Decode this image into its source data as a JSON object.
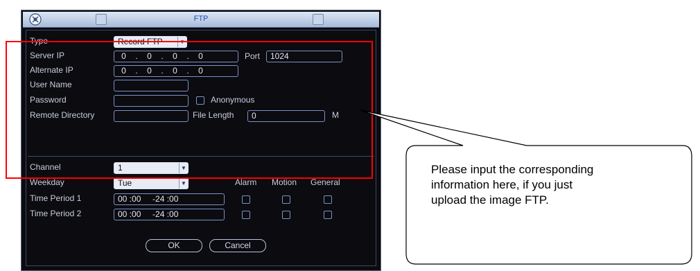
{
  "window": {
    "title": "FTP"
  },
  "form": {
    "type_label": "Type",
    "type_value": "Record FTP",
    "server_ip_label": "Server IP",
    "server_ip": [
      "0",
      "0",
      "0",
      "0"
    ],
    "port_label": "Port",
    "port_value": "1024",
    "alternate_ip_label": "Alternate IP",
    "alternate_ip": [
      "0",
      "0",
      "0",
      "0"
    ],
    "user_name_label": "User Name",
    "user_name_value": "",
    "password_label": "Password",
    "password_value": "",
    "anonymous_label": "Anonymous",
    "remote_dir_label": "Remote Directory",
    "remote_dir_value": "",
    "file_length_label": "File Length",
    "file_length_value": "0",
    "file_length_unit": "M"
  },
  "schedule": {
    "channel_label": "Channel",
    "channel_value": "1",
    "weekday_label": "Weekday",
    "weekday_value": "Tue",
    "col_alarm": "Alarm",
    "col_motion": "Motion",
    "col_general": "General",
    "period1_label": "Time Period 1",
    "period1_value": "00 :00     -24 :00",
    "period2_label": "Time Period 2",
    "period2_value": "00 :00     -24 :00"
  },
  "buttons": {
    "ok": "OK",
    "cancel": "Cancel"
  },
  "callout": {
    "lines": [
      "Please input the corresponding",
      "information here, if you just",
      "upload the image FTP."
    ]
  },
  "colors": {
    "highlight": "#ff0000",
    "panel_bg": "#0b0b10",
    "field_border": "#7b93c7"
  }
}
